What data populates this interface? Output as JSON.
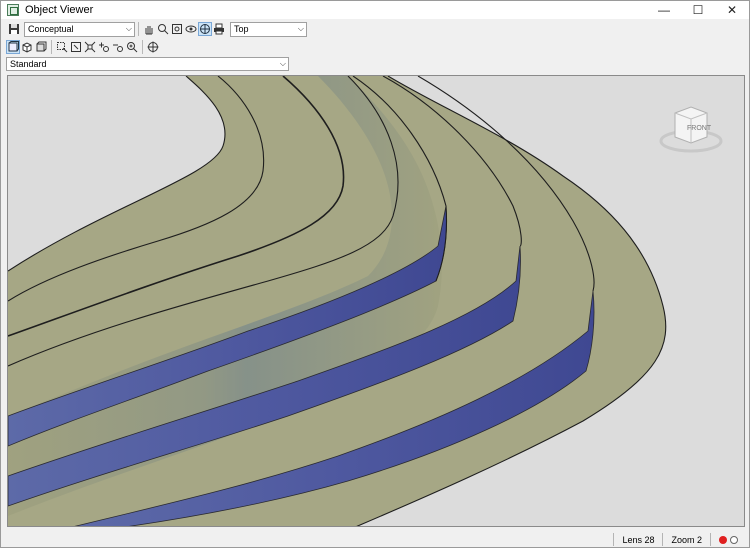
{
  "window": {
    "title": "Object Viewer",
    "minimize_glyph": "—",
    "maximize_glyph": "☐",
    "close_glyph": "✕"
  },
  "toolbar": {
    "visual_style": {
      "value": "Conceptual"
    },
    "view": {
      "value": "Top"
    },
    "icons1": [
      "save-icon",
      "pan-icon",
      "zoom-icon",
      "zoom-extents-icon",
      "orbit-icon",
      "free-orbit-icon",
      "print-icon"
    ],
    "icons2": [
      "view-top-icon",
      "view-iso-icon",
      "view-cube-icon",
      "zoom-window-icon",
      "zoom-realtime-icon",
      "zoom-extents-icon",
      "zoom-in-icon",
      "zoom-out-icon",
      "zoom-all-icon",
      "navigation-icon"
    ]
  },
  "style_select": {
    "value": "Standard"
  },
  "viewcube": {
    "face_label": "FRONT"
  },
  "status": {
    "lens": "Lens 28",
    "zoom": "Zoom 2",
    "color_red": "#e02020",
    "color_white": "#ffffff"
  },
  "colors": {
    "surface": "#a7a886",
    "side": "#5a62a6",
    "background": "#dcdcdc"
  }
}
